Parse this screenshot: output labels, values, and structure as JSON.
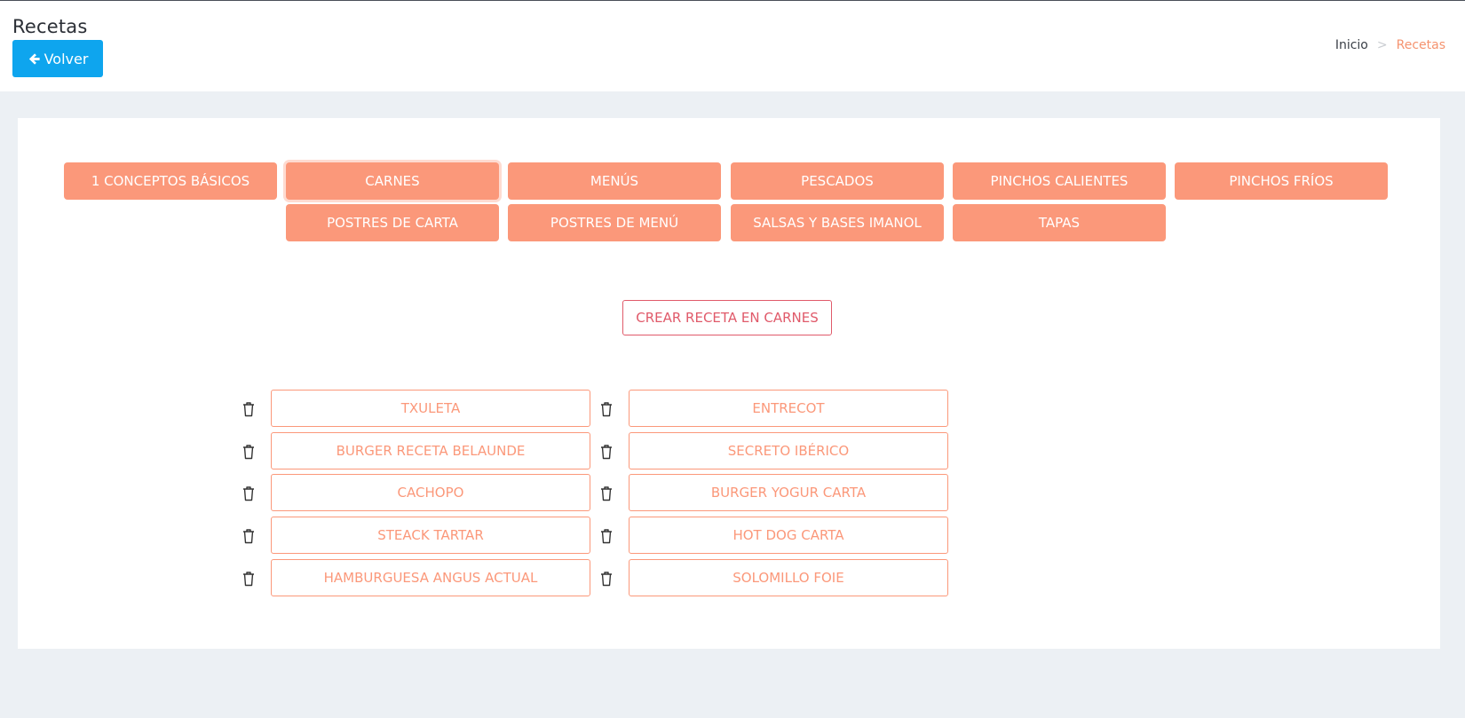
{
  "header": {
    "title": "Recetas",
    "back_label": "Volver",
    "breadcrumb": {
      "home": "Inicio",
      "separator": ">",
      "current": "Recetas"
    }
  },
  "categories": [
    {
      "label": "1 CONCEPTOS BÁSICOS",
      "active": false
    },
    {
      "label": "CARNES",
      "active": true
    },
    {
      "label": "MENÚS",
      "active": false
    },
    {
      "label": "PESCADOS",
      "active": false
    },
    {
      "label": "PINCHOS CALIENTES",
      "active": false
    },
    {
      "label": "PINCHOS FRÍOS",
      "active": false
    },
    {
      "label": "POSTRES DE CARTA",
      "active": false
    },
    {
      "label": "POSTRES DE MENÚ",
      "active": false
    },
    {
      "label": "SALSAS Y BASES IMANOL",
      "active": false
    },
    {
      "label": "TAPAS",
      "active": false
    }
  ],
  "create_button": "CREAR RECETA EN CARNES",
  "recipes": [
    {
      "label": "TXULETA",
      "icon": "trash-icon"
    },
    {
      "label": "ENTRECOT",
      "icon": "trash-icon"
    },
    {
      "label": "BURGER RECETA BELAUNDE",
      "icon": "trash-icon"
    },
    {
      "label": "SECRETO IBÉRICO",
      "icon": "trash-icon"
    },
    {
      "label": "CACHOPO",
      "icon": "trash-icon"
    },
    {
      "label": "BURGER YOGUR CARTA",
      "icon": "trash-icon"
    },
    {
      "label": "STEACK TARTAR",
      "icon": "trash-icon"
    },
    {
      "label": "HOT DOG CARTA",
      "icon": "trash-icon"
    },
    {
      "label": "HAMBURGUESA ANGUS ACTUAL",
      "icon": "trash-icon"
    },
    {
      "label": "SOLOMILLO FOIE",
      "icon": "trash-icon"
    }
  ],
  "colors": {
    "accent": "#fb987a",
    "primary_button": "#0ea5ee",
    "create_button": "#e05a6a",
    "page_background": "#ecf0f4"
  }
}
